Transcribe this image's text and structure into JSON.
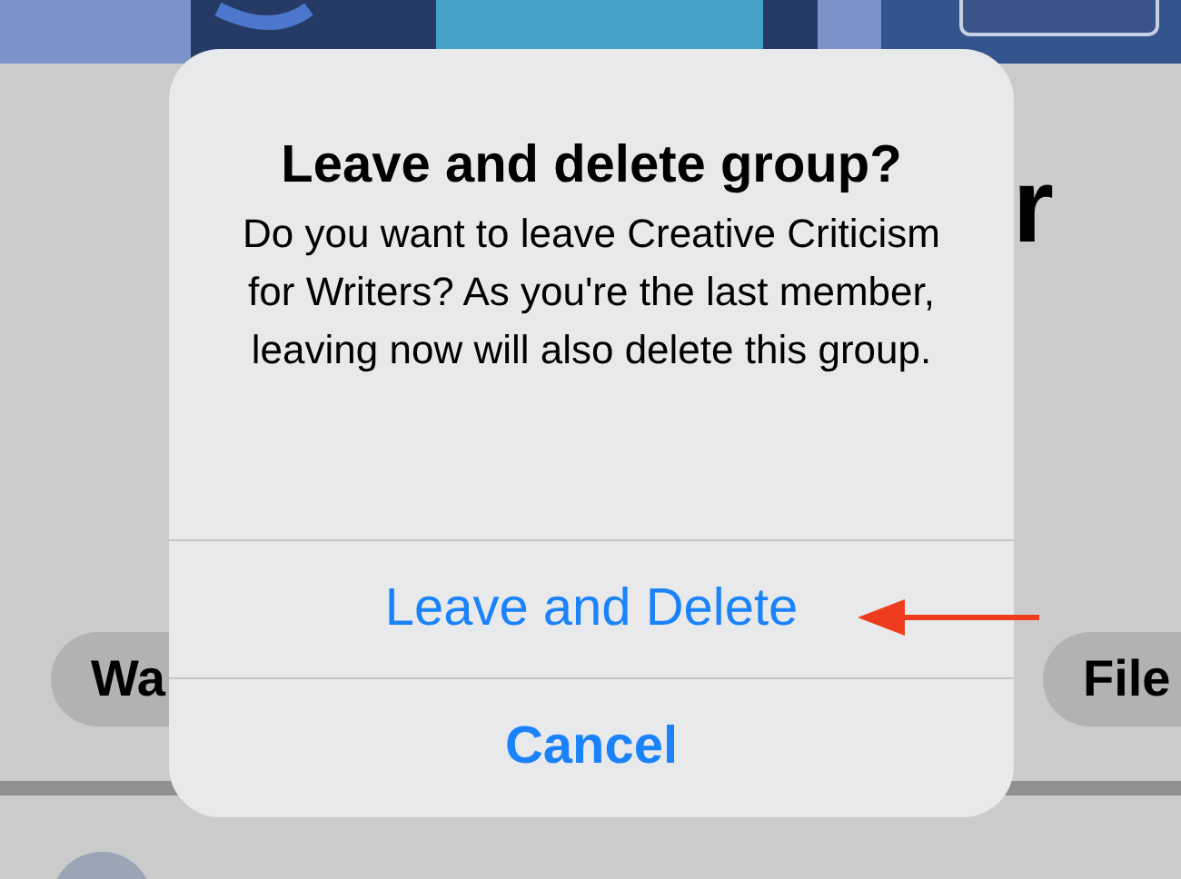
{
  "background": {
    "title_fragment": "r",
    "chips": [
      "Wa",
      "File"
    ]
  },
  "dialog": {
    "title": "Leave and delete group?",
    "message": "Do you want to leave Creative Criticism for Writers? As you're the last member, leaving now will also delete this group.",
    "actions": [
      {
        "label": "Leave and Delete",
        "kind": "default",
        "highlighted": true
      },
      {
        "label": "Cancel",
        "kind": "cancel",
        "highlighted": false
      }
    ]
  }
}
